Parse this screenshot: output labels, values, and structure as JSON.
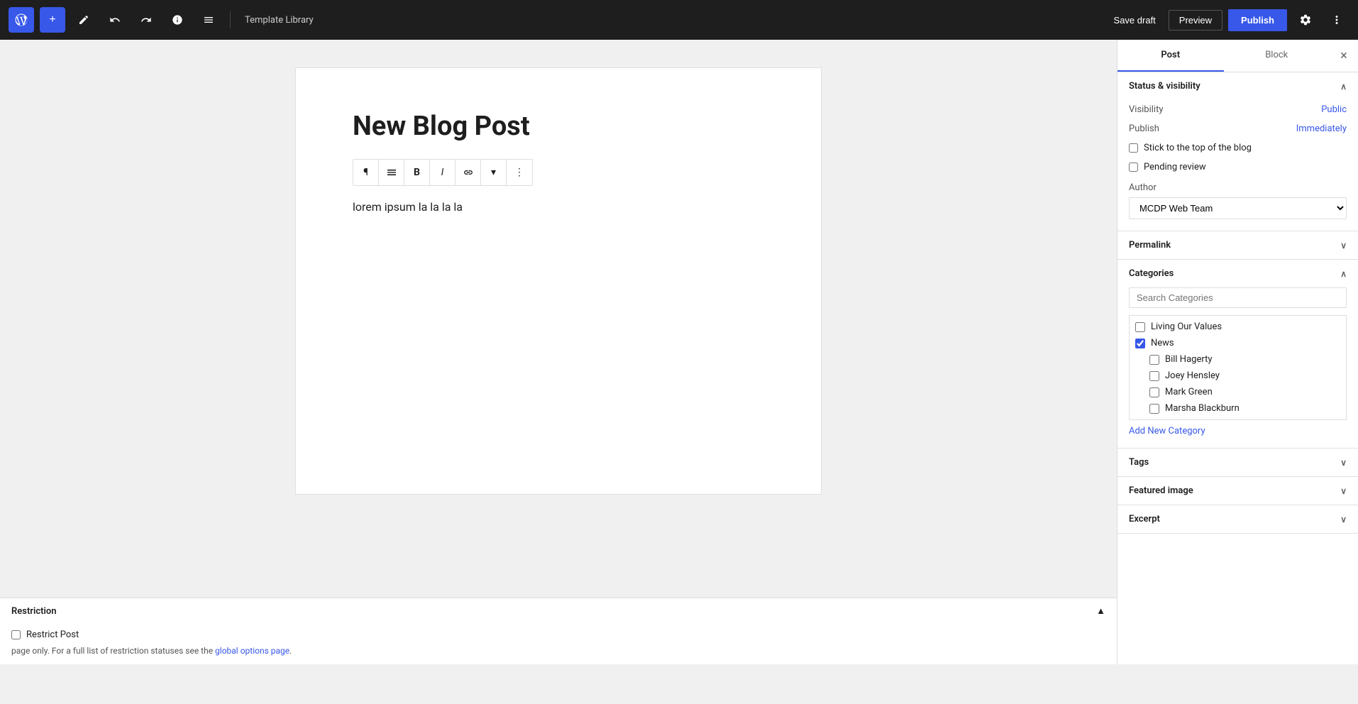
{
  "topbar": {
    "wp_logo": "W",
    "add_label": "+",
    "edit_icon": "✎",
    "undo_icon": "↩",
    "redo_icon": "↪",
    "info_icon": "ℹ",
    "list_icon": "≡",
    "template_library": "Template Library",
    "save_draft_label": "Save draft",
    "preview_label": "Preview",
    "publish_label": "Publish",
    "settings_icon": "⚙",
    "more_icon": "⋮"
  },
  "editor": {
    "post_title": "New Blog Post",
    "post_body": "lorem ipsum la la la la"
  },
  "toolbar": {
    "paragraph": "¶",
    "align": "≡",
    "bold": "B",
    "italic": "I",
    "link": "🔗",
    "dropdown": "▾",
    "more": "⋮"
  },
  "sidebar": {
    "tab_post": "Post",
    "tab_block": "Block",
    "close_icon": "×",
    "status_visibility": {
      "section_title": "Status & visibility",
      "visibility_label": "Visibility",
      "visibility_value": "Public",
      "publish_label": "Publish",
      "publish_value": "Immediately",
      "stick_label": "Stick to the top of the blog",
      "pending_review_label": "Pending review",
      "author_label": "Author",
      "author_value": "MCDP Web Team"
    },
    "permalink": {
      "section_title": "Permalink"
    },
    "categories": {
      "section_title": "Categories",
      "search_placeholder": "Search Categories",
      "items": [
        {
          "label": "Living Our Values",
          "checked": false,
          "sub": false
        },
        {
          "label": "News",
          "checked": true,
          "sub": false
        },
        {
          "label": "Bill Hagerty",
          "checked": false,
          "sub": true
        },
        {
          "label": "Joey Hensley",
          "checked": false,
          "sub": true
        },
        {
          "label": "Mark Green",
          "checked": false,
          "sub": true
        },
        {
          "label": "Marsha Blackburn",
          "checked": false,
          "sub": true
        }
      ],
      "add_new": "Add New Category"
    },
    "tags": {
      "section_title": "Tags"
    },
    "featured_image": {
      "section_title": "Featured image"
    },
    "excerpt": {
      "section_title": "Excerpt"
    }
  },
  "restriction": {
    "section_title": "Restriction",
    "chevron": "▲",
    "restrict_label": "Restrict Post",
    "note_text": "page only. For a full list of restriction statuses see the ",
    "link_text": "global options page",
    "link_href": "#"
  }
}
